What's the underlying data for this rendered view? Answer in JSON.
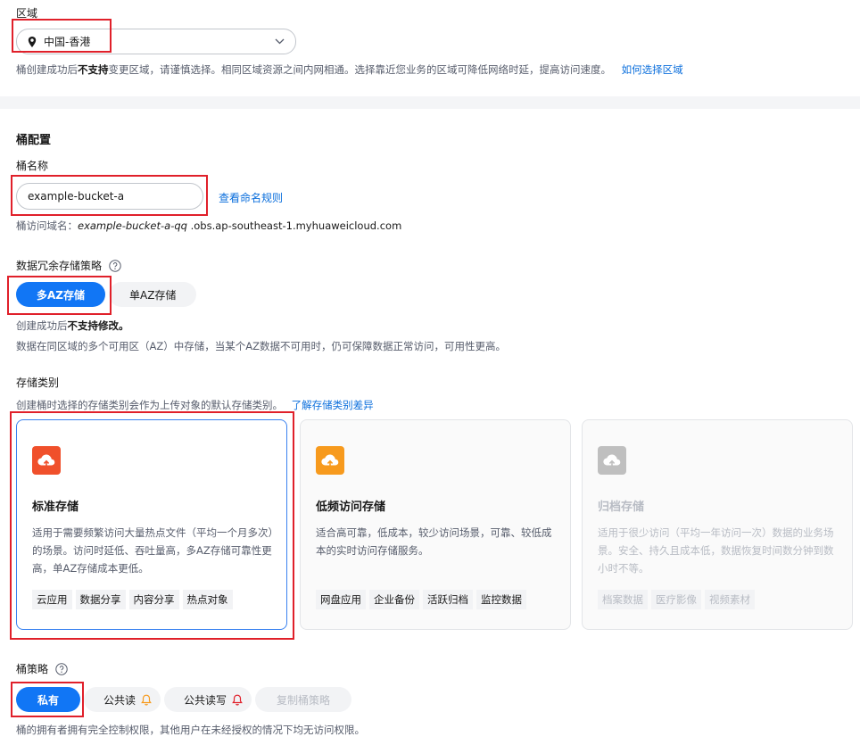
{
  "region": {
    "label": "区域",
    "value": "中国-香港",
    "hint_pre": "桶创建成功后",
    "hint_bold": "不支持",
    "hint_post": "变更区域，请谨慎选择。相同区域资源之间内网相通。选择靠近您业务的区域可降低网络时延，提高访问速度。",
    "hint_link": "如何选择区域"
  },
  "config": {
    "title": "桶配置",
    "name_label": "桶名称",
    "name_value": "example-bucket-a",
    "naming_rules_link": "查看命名规则",
    "domain_prefix": "桶访问域名：",
    "domain_italic": "example-bucket-a-qq",
    "domain_suffix": ".obs.ap-southeast-1.myhuaweicloud.com"
  },
  "redundancy": {
    "label": "数据冗余存储策略",
    "options": [
      "多AZ存储",
      "单AZ存储"
    ],
    "hint1_pre": "创建成功后",
    "hint1_bold": "不支持修改。",
    "hint2": "数据在同区域的多个可用区（AZ）中存储，当某个AZ数据不可用时，仍可保障数据正常访问，可用性更高。"
  },
  "storage": {
    "label": "存储类别",
    "hint": "创建桶时选择的存储类别会作为上传对象的默认存储类别。",
    "hint_link": "了解存储类别差异",
    "cards": [
      {
        "title": "标准存储",
        "desc": "适用于需要频繁访问大量热点文件（平均一个月多次）的场景。访问时延低、吞吐量高，多AZ存储可靠性更高，单AZ存储成本更低。",
        "tags": [
          "云应用",
          "数据分享",
          "内容分享",
          "热点对象"
        ]
      },
      {
        "title": "低频访问存储",
        "desc": "适合高可靠，低成本，较少访问场景，可靠、较低成本的实时访问存储服务。",
        "tags": [
          "网盘应用",
          "企业备份",
          "活跃归档",
          "监控数据"
        ]
      },
      {
        "title": "归档存储",
        "desc": "适用于很少访问（平均一年访问一次）数据的业务场景。安全、持久且成本低，数据恢复时间数分钟到数小时不等。",
        "tags": [
          "档案数据",
          "医疗影像",
          "视频素材"
        ]
      }
    ]
  },
  "policy": {
    "label": "桶策略",
    "options": [
      "私有",
      "公共读",
      "公共读写",
      "复制桶策略"
    ],
    "hint": "桶的拥有者拥有完全控制权限，其他用户在未经授权的情况下均无访问权限。"
  },
  "colors": {
    "primary": "#1176f5",
    "link": "#0a6edc",
    "standard_icon": "#f0502b",
    "infrequent_icon": "#f79a1d",
    "archive_icon": "#bfbfbf",
    "warning": "#f79a1d",
    "danger": "#e0202a",
    "annotation": "#e0202a"
  }
}
